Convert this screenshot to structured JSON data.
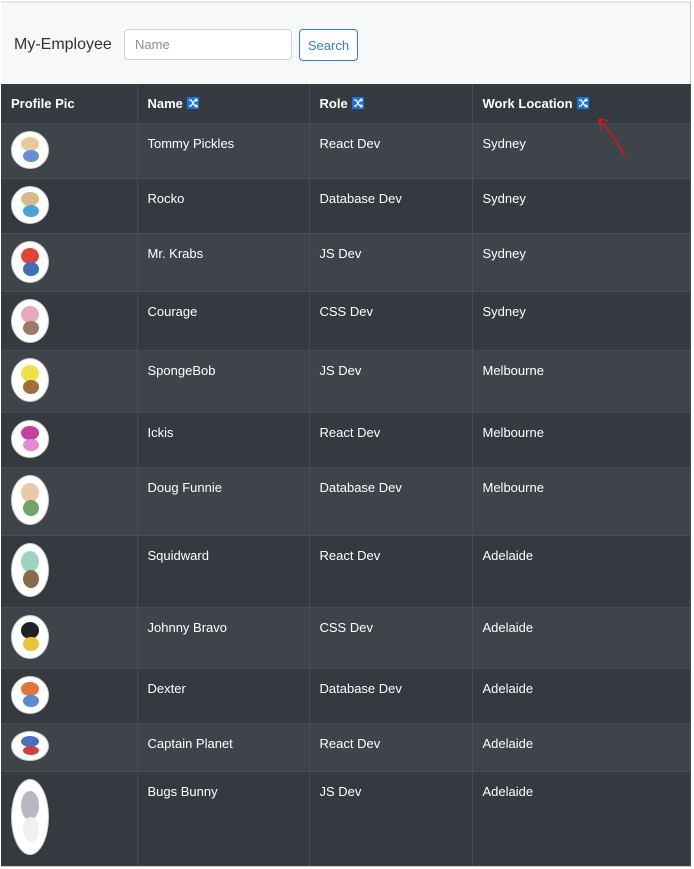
{
  "navbar": {
    "brand": "My-Employee",
    "search_placeholder": "Name",
    "search_button": "Search"
  },
  "table": {
    "headers": {
      "profile": "Profile Pic",
      "name": "Name",
      "role": "Role",
      "location": "Work Location"
    },
    "rows": [
      {
        "name": "Tommy Pickles",
        "role": "React Dev",
        "location": "Sydney",
        "avatar_colors": [
          "#e8c9a0",
          "#6a8fd1"
        ]
      },
      {
        "name": "Rocko",
        "role": "Database Dev",
        "location": "Sydney",
        "avatar_colors": [
          "#d8b98a",
          "#4aa3d9"
        ]
      },
      {
        "name": "Mr. Krabs",
        "role": "JS Dev",
        "location": "Sydney",
        "avatar_colors": [
          "#e0443a",
          "#3e6fb8"
        ]
      },
      {
        "name": "Courage",
        "role": "CSS Dev",
        "location": "Sydney",
        "avatar_colors": [
          "#e8a8c0",
          "#9a7a6a"
        ]
      },
      {
        "name": "SpongeBob",
        "role": "JS Dev",
        "location": "Melbourne",
        "avatar_colors": [
          "#f2e04a",
          "#a0703a"
        ]
      },
      {
        "name": "Ickis",
        "role": "React Dev",
        "location": "Melbourne",
        "avatar_colors": [
          "#c63ea0",
          "#e48ad0"
        ]
      },
      {
        "name": "Doug Funnie",
        "role": "Database Dev",
        "location": "Melbourne",
        "avatar_colors": [
          "#e9c9a8",
          "#6fa46a"
        ]
      },
      {
        "name": "Squidward",
        "role": "React Dev",
        "location": "Adelaide",
        "avatar_colors": [
          "#9ed2c4",
          "#8a6a4a"
        ]
      },
      {
        "name": "Johnny Bravo",
        "role": "CSS Dev",
        "location": "Adelaide",
        "avatar_colors": [
          "#222222",
          "#e8c43a"
        ]
      },
      {
        "name": "Dexter",
        "role": "Database Dev",
        "location": "Adelaide",
        "avatar_colors": [
          "#e2763a",
          "#5a8ad0"
        ]
      },
      {
        "name": "Captain Planet",
        "role": "React Dev",
        "location": "Adelaide",
        "avatar_colors": [
          "#4a6fc0",
          "#d04040"
        ]
      },
      {
        "name": "Bugs Bunny",
        "role": "JS Dev",
        "location": "Adelaide",
        "avatar_colors": [
          "#b8b8c4",
          "#f0f0f0"
        ]
      }
    ]
  },
  "colors": {
    "header_bg": "#343a40",
    "row_alt_bg": "#3f444b",
    "accent": "#1a73d9",
    "annotation": "#d01818"
  }
}
